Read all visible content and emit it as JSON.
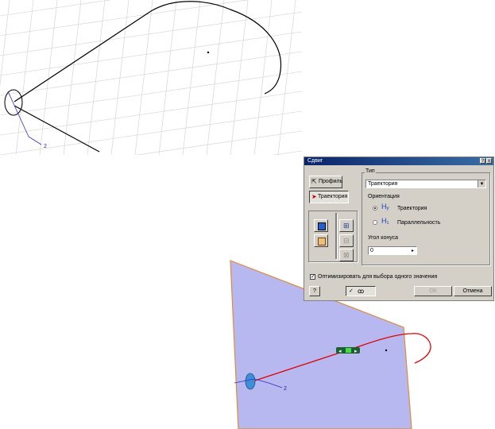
{
  "sketch": {
    "dimension_label": "2"
  },
  "preview": {
    "dimension_label": "2"
  },
  "dialog": {
    "title": "Сдвиг",
    "title_buttons": [
      "?",
      "x"
    ],
    "profile_label": "Профиль",
    "path_label": "Траектория",
    "type_group_label": "Тип",
    "type_value": "Траектория",
    "orientation_label": "Ориентация",
    "orientation_options": [
      "Траектория",
      "Параллельность"
    ],
    "orientation_selected": "Траектория",
    "taper_label": "Угол конуса",
    "taper_value": "0",
    "optimize_label": "Оптимизировать для выбора одного значения",
    "optimize_checked": true,
    "ok_label": "ОК",
    "cancel_label": "Отмена",
    "help_label": "?"
  },
  "colors": {
    "sheet_fill": "#b8b8f0",
    "sheet_edge": "#e08a3a",
    "sweep_path": "#e00000",
    "grid": "#c8c8c8",
    "curve": "#000000",
    "dimension": "#2020c0"
  }
}
